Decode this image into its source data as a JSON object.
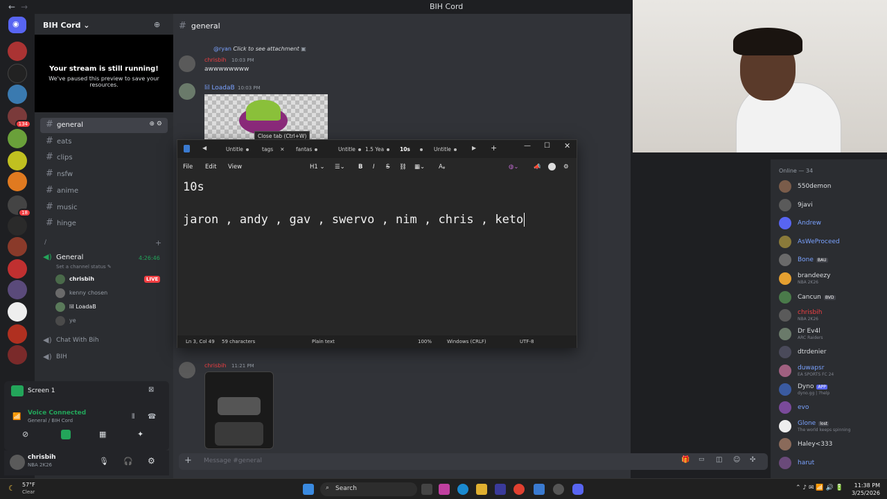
{
  "app_title": "BIH Cord",
  "server": {
    "name": "BIH Cord"
  },
  "stream_preview": {
    "title": "Your stream is still running!",
    "subtitle": "We've paused this preview to save your resources."
  },
  "channels": [
    {
      "name": "general",
      "active": true
    },
    {
      "name": "eats"
    },
    {
      "name": "clips"
    },
    {
      "name": "nsfw"
    },
    {
      "name": "anime"
    },
    {
      "name": "music"
    },
    {
      "name": "hinge"
    }
  ],
  "category_slash": "/",
  "voice_channel": {
    "name": "General",
    "time": "4:26:46",
    "status_prompt": "Set a channel status",
    "users": [
      "chrisbih",
      "kenny chosen",
      "lil LoadaB",
      "ye"
    ],
    "live_label": "LIVE"
  },
  "extra_channels": [
    "Chat With Bih",
    "BIH"
  ],
  "screen_share": {
    "label": "Screen 1"
  },
  "voice_status": {
    "title": "Voice Connected",
    "sub": "General / BIH Cord"
  },
  "current_user": {
    "name": "chrisbih",
    "status": "NBA 2K26"
  },
  "chat": {
    "channel": "general",
    "reply_to": "@ryan",
    "reply_text": "Click to see attachment",
    "msg1": {
      "author": "chrisbih",
      "time": "10:03 PM",
      "text": "awwwwwwww"
    },
    "msg2": {
      "author": "lil LoadaB",
      "time": "10:03 PM"
    },
    "msg3": {
      "author": "chrisbih",
      "time": "11:21 PM"
    },
    "input_placeholder": "Message #general"
  },
  "members_header": "Online — 34",
  "members": [
    {
      "name": "550demon",
      "color": "#dbdee1",
      "avatar": "#7a5c4a"
    },
    {
      "name": "9javi",
      "color": "#dbdee1",
      "avatar": "#5a5a5a"
    },
    {
      "name": "Andrew",
      "color": "#7aa2ff",
      "avatar": "#5865f2"
    },
    {
      "name": "AsWeProceed",
      "color": "#7aa2ff",
      "avatar": "#8a7a3a"
    },
    {
      "name": "Bone",
      "tag": "BAU",
      "color": "#7aa2ff",
      "avatar": "#6a6a6a"
    },
    {
      "name": "brandeezy",
      "status": "NBA 2K26",
      "color": "#dbdee1",
      "avatar": "#e5a030"
    },
    {
      "name": "Cancun",
      "tag": "BVD",
      "color": "#dbdee1",
      "avatar": "#4a7a4a"
    },
    {
      "name": "chrisbih",
      "status": "NBA 2K26",
      "color": "#f23f43",
      "avatar": "#5a5a5a"
    },
    {
      "name": "Dr Ev4l",
      "status": "ARC Raiders",
      "color": "#dbdee1",
      "avatar": "#6a7a6a"
    },
    {
      "name": "dtrdenier",
      "color": "#dbdee1",
      "avatar": "#4a4a5a"
    },
    {
      "name": "duwapsr",
      "status": "EA SPORTS FC 24",
      "color": "#7aa2ff",
      "avatar": "#a06080"
    },
    {
      "name": "Dyno",
      "tag": "APP",
      "status": "dyno.gg | ?help",
      "color": "#dbdee1",
      "avatar": "#3a5aa0"
    },
    {
      "name": "evo",
      "color": "#7aa2ff",
      "avatar": "#7a4a9a"
    },
    {
      "name": "Glone",
      "tag": "lost",
      "status": "The world keeps spinning",
      "color": "#7aa2ff",
      "avatar": "#eeeeee"
    },
    {
      "name": "Haley<333",
      "color": "#dbdee1",
      "avatar": "#8a6a5a"
    },
    {
      "name": "harut",
      "color": "#7aa2ff",
      "avatar": "#6a4a7a"
    }
  ],
  "notepad": {
    "tabs": [
      "Untitle",
      "tags",
      "fantas",
      "Untitle",
      "1.5 Yea",
      "10s",
      "Untitle"
    ],
    "active_tab": "10s",
    "tooltip": "Close tab (Ctrl+W)",
    "menu": [
      "File",
      "Edit",
      "View"
    ],
    "heading": "H1",
    "line1": "10s",
    "line2": "jaron , andy , gav , swervo , nim , chris , keto",
    "status": {
      "position": "Ln 3, Col 49",
      "chars": "59 characters",
      "format": "Plain text",
      "zoom": "100%",
      "eol": "Windows (CRLF)",
      "encoding": "UTF-8"
    }
  },
  "taskbar": {
    "weather_temp": "57°F",
    "weather_desc": "Clear",
    "search_label": "Search",
    "time": "11:38 PM",
    "date": "3/25/2026"
  },
  "colors": {
    "accent": "#5865f2",
    "live": "#f23f43",
    "online": "#23a55a"
  }
}
